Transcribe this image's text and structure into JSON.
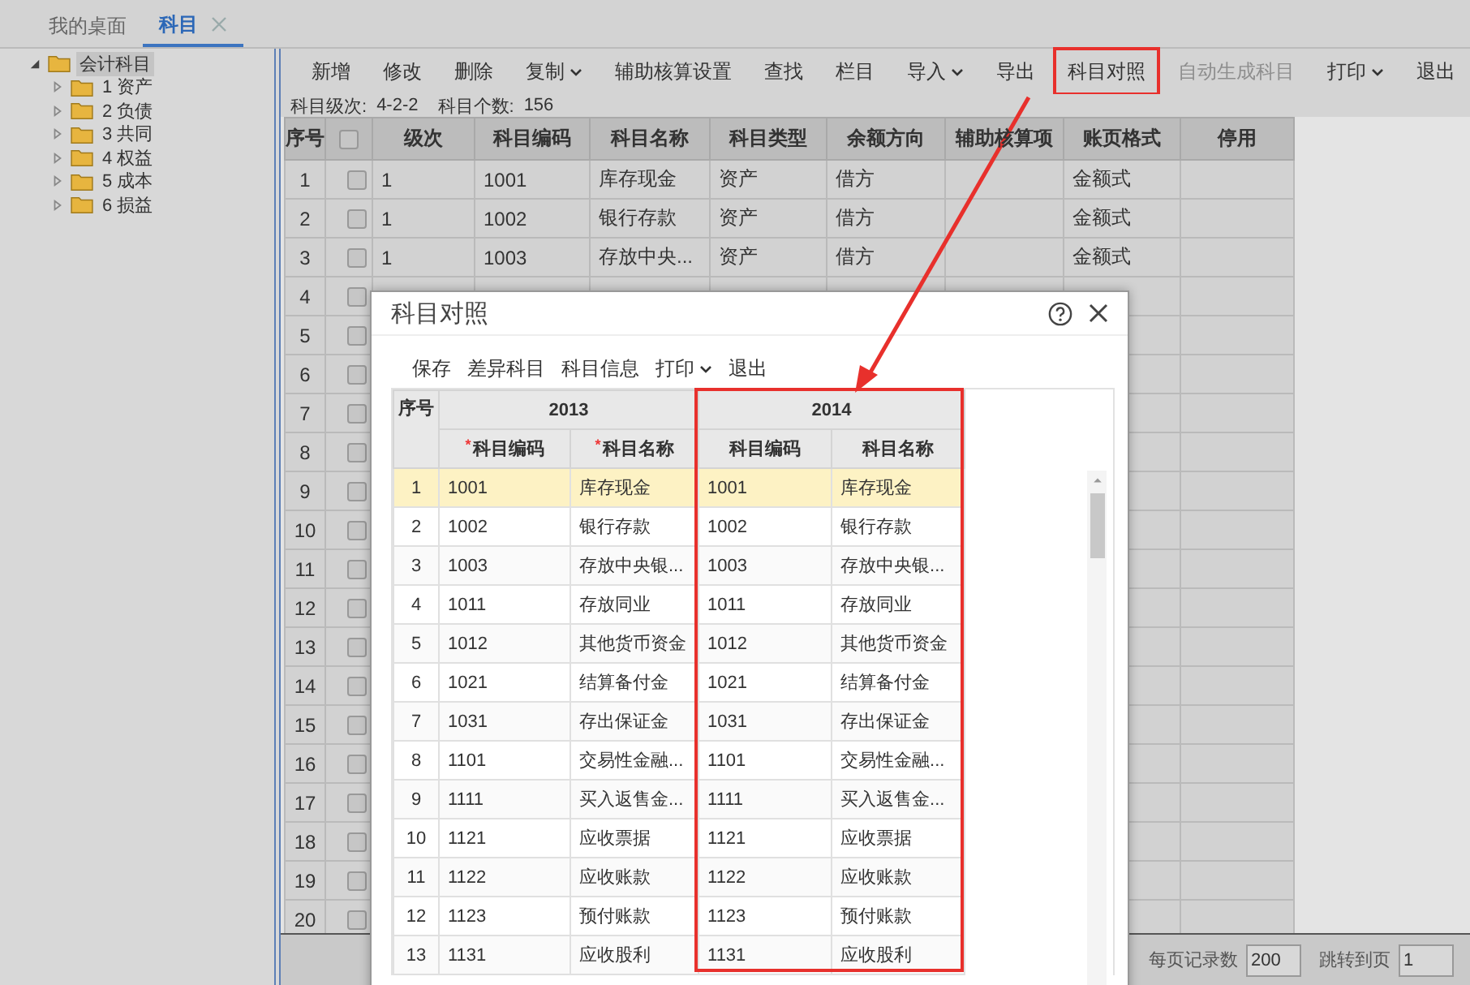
{
  "tabs": [
    {
      "label": "我的桌面",
      "selected": false,
      "closable": false
    },
    {
      "label": "科目",
      "selected": true,
      "closable": true
    }
  ],
  "tree": {
    "label": "会计科目",
    "expanded": true,
    "selected": true,
    "children": [
      {
        "label": "1 资产",
        "expanded": false
      },
      {
        "label": "2 负债",
        "expanded": false
      },
      {
        "label": "3 共同",
        "expanded": false
      },
      {
        "label": "4 权益",
        "expanded": false
      },
      {
        "label": "5 成本",
        "expanded": false
      },
      {
        "label": "6 损益",
        "expanded": false
      }
    ]
  },
  "toolbar": [
    {
      "label": "新增",
      "dropdown": false,
      "disabled": false,
      "highlighted": false
    },
    {
      "label": "修改",
      "dropdown": false,
      "disabled": false,
      "highlighted": false
    },
    {
      "label": "删除",
      "dropdown": false,
      "disabled": false,
      "highlighted": false
    },
    {
      "label": "复制",
      "dropdown": true,
      "disabled": false,
      "highlighted": false
    },
    {
      "label": "辅助核算设置",
      "dropdown": false,
      "disabled": false,
      "highlighted": false
    },
    {
      "label": "查找",
      "dropdown": false,
      "disabled": false,
      "highlighted": false
    },
    {
      "label": "栏目",
      "dropdown": false,
      "disabled": false,
      "highlighted": false
    },
    {
      "label": "导入",
      "dropdown": true,
      "disabled": false,
      "highlighted": false
    },
    {
      "label": "导出",
      "dropdown": false,
      "disabled": false,
      "highlighted": false
    },
    {
      "label": "科目对照",
      "dropdown": false,
      "disabled": false,
      "highlighted": true
    },
    {
      "label": "自动生成科目",
      "dropdown": false,
      "disabled": true,
      "highlighted": false
    },
    {
      "label": "打印",
      "dropdown": true,
      "disabled": false,
      "highlighted": false
    },
    {
      "label": "退出",
      "dropdown": false,
      "disabled": false,
      "highlighted": false
    }
  ],
  "info": {
    "level_label": "科目级次:",
    "level_value": "4-2-2",
    "count_label": "科目个数:",
    "count_value": "156"
  },
  "table": {
    "columns": [
      {
        "kind": "text",
        "label": "序号"
      },
      {
        "kind": "checkbox",
        "checked": false
      },
      {
        "kind": "text",
        "label": "级次"
      },
      {
        "kind": "text",
        "label": "科目编码"
      },
      {
        "kind": "text",
        "label": "科目名称"
      },
      {
        "kind": "text",
        "label": "科目类型"
      },
      {
        "kind": "text",
        "label": "余额方向"
      },
      {
        "kind": "text",
        "label": "辅助核算项"
      },
      {
        "kind": "text",
        "label": "账页格式"
      },
      {
        "kind": "text",
        "label": "停用"
      }
    ],
    "rows": [
      {
        "no": "1",
        "checked": false,
        "level": "1",
        "code": "1001",
        "name": "库存现金",
        "type": "资产",
        "direction": "借方",
        "format": "金额式"
      },
      {
        "no": "2",
        "checked": false,
        "level": "1",
        "code": "1002",
        "name": "银行存款",
        "type": "资产",
        "direction": "借方",
        "format": "金额式"
      },
      {
        "no": "3",
        "checked": false,
        "level": "1",
        "code": "1003",
        "name": "存放中央...",
        "type": "资产",
        "direction": "借方",
        "format": "金额式"
      },
      {
        "no": "4",
        "checked": false
      },
      {
        "no": "5",
        "checked": false
      },
      {
        "no": "6",
        "checked": false
      },
      {
        "no": "7",
        "checked": false
      },
      {
        "no": "8",
        "checked": false
      },
      {
        "no": "9",
        "checked": false
      },
      {
        "no": "10",
        "checked": false
      },
      {
        "no": "11",
        "checked": false
      },
      {
        "no": "12",
        "checked": false
      },
      {
        "no": "13",
        "checked": false
      },
      {
        "no": "14",
        "checked": false
      },
      {
        "no": "15",
        "checked": false
      },
      {
        "no": "16",
        "checked": false
      },
      {
        "no": "17",
        "checked": false
      },
      {
        "no": "18",
        "checked": false
      },
      {
        "no": "19",
        "checked": false
      },
      {
        "no": "20",
        "checked": false
      }
    ]
  },
  "pager": {
    "page_size_label": "每页记录数",
    "page_size": "200",
    "jump_label": "跳转到页",
    "page": "1"
  },
  "dialog": {
    "title": "科目对照",
    "toolbar": [
      {
        "label": "保存",
        "dropdown": false
      },
      {
        "label": "差异科目",
        "dropdown": false
      },
      {
        "label": "科目信息",
        "dropdown": false
      },
      {
        "label": "打印",
        "dropdown": true
      },
      {
        "label": "退出",
        "dropdown": false
      }
    ],
    "table": {
      "seq_header": "序号",
      "groups": [
        {
          "label": "2013",
          "highlighted": false,
          "columns": [
            {
              "label": "科目编码",
              "required_mark": "*"
            },
            {
              "label": "科目名称",
              "required_mark": "*"
            }
          ]
        },
        {
          "label": "2014",
          "highlighted": true,
          "columns": [
            {
              "label": "科目编码"
            },
            {
              "label": "科目名称"
            }
          ]
        }
      ],
      "rows": [
        {
          "no": "1",
          "selected": true,
          "cells": [
            "1001",
            "库存现金",
            "1001",
            "库存现金"
          ]
        },
        {
          "no": "2",
          "selected": false,
          "cells": [
            "1002",
            "银行存款",
            "1002",
            "银行存款"
          ]
        },
        {
          "no": "3",
          "selected": false,
          "cells": [
            "1003",
            "存放中央银...",
            "1003",
            "存放中央银..."
          ]
        },
        {
          "no": "4",
          "selected": false,
          "cells": [
            "1011",
            "存放同业",
            "1011",
            "存放同业"
          ]
        },
        {
          "no": "5",
          "selected": false,
          "cells": [
            "1012",
            "其他货币资金",
            "1012",
            "其他货币资金"
          ]
        },
        {
          "no": "6",
          "selected": false,
          "cells": [
            "1021",
            "结算备付金",
            "1021",
            "结算备付金"
          ]
        },
        {
          "no": "7",
          "selected": false,
          "cells": [
            "1031",
            "存出保证金",
            "1031",
            "存出保证金"
          ]
        },
        {
          "no": "8",
          "selected": false,
          "cells": [
            "1101",
            "交易性金融...",
            "1101",
            "交易性金融..."
          ]
        },
        {
          "no": "9",
          "selected": false,
          "cells": [
            "1111",
            "买入返售金...",
            "1111",
            "买入返售金..."
          ]
        },
        {
          "no": "10",
          "selected": false,
          "cells": [
            "1121",
            "应收票据",
            "1121",
            "应收票据"
          ]
        },
        {
          "no": "11",
          "selected": false,
          "cells": [
            "1122",
            "应收账款",
            "1122",
            "应收账款"
          ]
        },
        {
          "no": "12",
          "selected": false,
          "cells": [
            "1123",
            "预付账款",
            "1123",
            "预付账款"
          ]
        },
        {
          "no": "13",
          "selected": false,
          "cells": [
            "1131",
            "应收股利",
            "1131",
            "应收股利"
          ]
        }
      ]
    }
  }
}
